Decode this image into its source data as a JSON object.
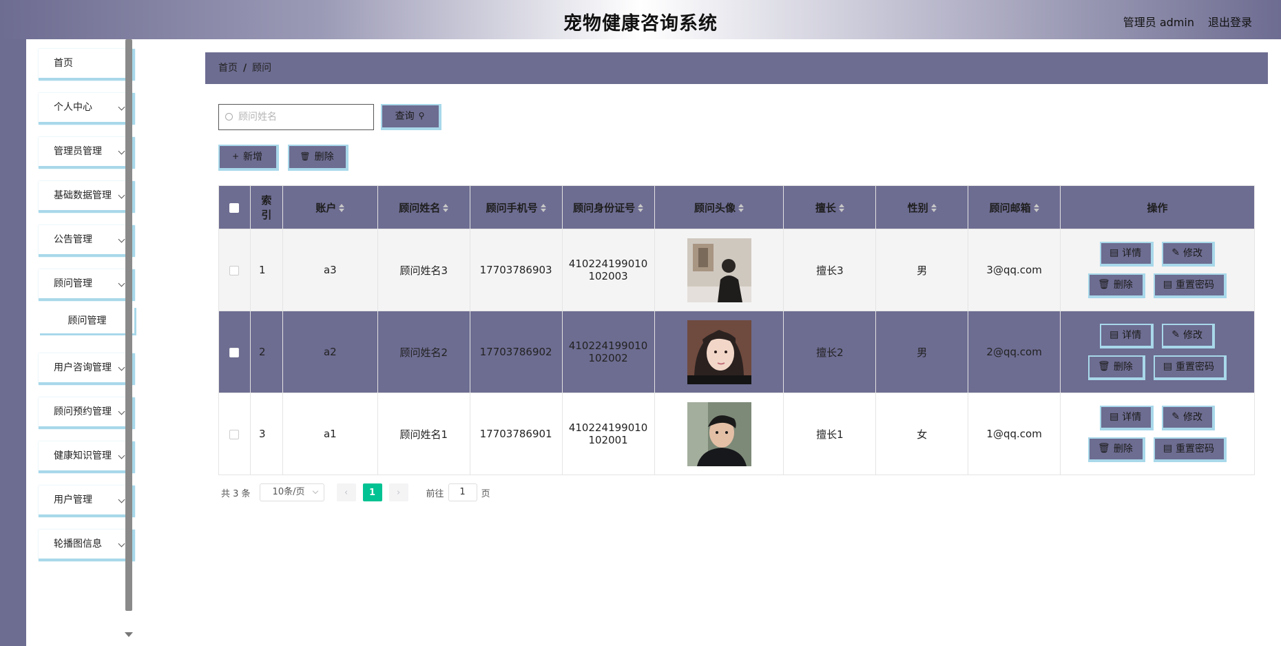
{
  "header": {
    "title": "宠物健康咨询系统",
    "user": "管理员 admin",
    "logout": "退出登录"
  },
  "sidebar": {
    "items": [
      {
        "label": "首页",
        "has_children": false
      },
      {
        "label": "个人中心",
        "has_children": true
      },
      {
        "label": "管理员管理",
        "has_children": true
      },
      {
        "label": "基础数据管理",
        "has_children": true
      },
      {
        "label": "公告管理",
        "has_children": true
      },
      {
        "label": "顾问管理",
        "has_children": true
      },
      {
        "label": "用户咨询管理",
        "has_children": true
      },
      {
        "label": "顾问预约管理",
        "has_children": true
      },
      {
        "label": "健康知识管理",
        "has_children": true
      },
      {
        "label": "用户管理",
        "has_children": true
      },
      {
        "label": "轮播图信息",
        "has_children": true
      }
    ],
    "submenu": {
      "label": "顾问管理"
    }
  },
  "breadcrumb": {
    "home": "首页",
    "separator": "/",
    "current": "顾问"
  },
  "search": {
    "placeholder": "顾问姓名",
    "button": "查询"
  },
  "actions": {
    "add": "新增",
    "delete": "删除"
  },
  "table": {
    "headers": {
      "index": "索引",
      "account": "账户",
      "name": "顾问姓名",
      "phone": "顾问手机号",
      "idcard": "顾问身份证号",
      "avatar": "顾问头像",
      "specialty": "擅长",
      "gender": "性别",
      "email": "顾问邮箱",
      "ops": "操作"
    },
    "rows": [
      {
        "index": "1",
        "account": "a3",
        "name": "顾问姓名3",
        "phone": "17703786903",
        "idcard_l1": "410224199010",
        "idcard_l2": "102003",
        "specialty": "擅长3",
        "gender": "男",
        "email": "3@qq.com"
      },
      {
        "index": "2",
        "account": "a2",
        "name": "顾问姓名2",
        "phone": "17703786902",
        "idcard_l1": "410224199010",
        "idcard_l2": "102002",
        "specialty": "擅长2",
        "gender": "男",
        "email": "2@qq.com"
      },
      {
        "index": "3",
        "account": "a1",
        "name": "顾问姓名1",
        "phone": "17703786901",
        "idcard_l1": "410224199010",
        "idcard_l2": "102001",
        "specialty": "擅长1",
        "gender": "女",
        "email": "1@qq.com"
      }
    ],
    "op_labels": {
      "detail": "详情",
      "edit": "修改",
      "delete": "删除",
      "reset": "重置密码"
    }
  },
  "pagination": {
    "total": "共 3 条",
    "page_size": "10条/页",
    "current": "1",
    "goto": "前往",
    "goto_value": "1",
    "page_unit": "页"
  },
  "colors": {
    "accent": "#6d6c91",
    "border_accent": "#a8d8ea",
    "pager_active": "#00c292"
  }
}
